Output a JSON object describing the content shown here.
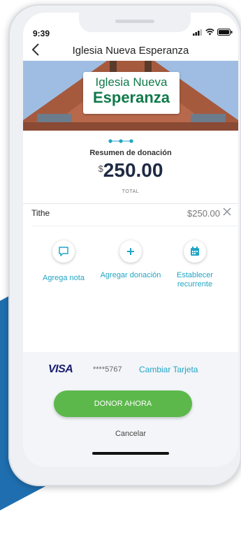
{
  "status": {
    "time": "9:39"
  },
  "navbar": {
    "title": "Iglesia Nueva Esperanza"
  },
  "hero": {
    "sign_line1": "Iglesia Nueva",
    "sign_line2": "Esperanza"
  },
  "summary": {
    "label": "Resumen de donación",
    "currency": "$",
    "amount": "250.00",
    "total_label": "TOTAL"
  },
  "line_item": {
    "name": "Tithe",
    "amount": "$250.00"
  },
  "actions": [
    {
      "label": "Agrega nota",
      "icon": "chat-bubble-icon"
    },
    {
      "label": "Agregar donación",
      "icon": "plus-icon"
    },
    {
      "label": "Establecer recurrente",
      "icon": "calendar-icon"
    }
  ],
  "payment": {
    "card_brand": "VISA",
    "card_number": "****5767",
    "change_label": "Cambiar Tarjeta"
  },
  "buttons": {
    "donate": "DONOR AHORA",
    "cancel": "Cancelar"
  },
  "colors": {
    "accent": "#22a5c6",
    "donate_green": "#5cb84b",
    "visa_blue": "#1a1f71",
    "sign_green": "#0f7a4a"
  },
  "progress": {
    "steps": 3,
    "current": 3
  }
}
